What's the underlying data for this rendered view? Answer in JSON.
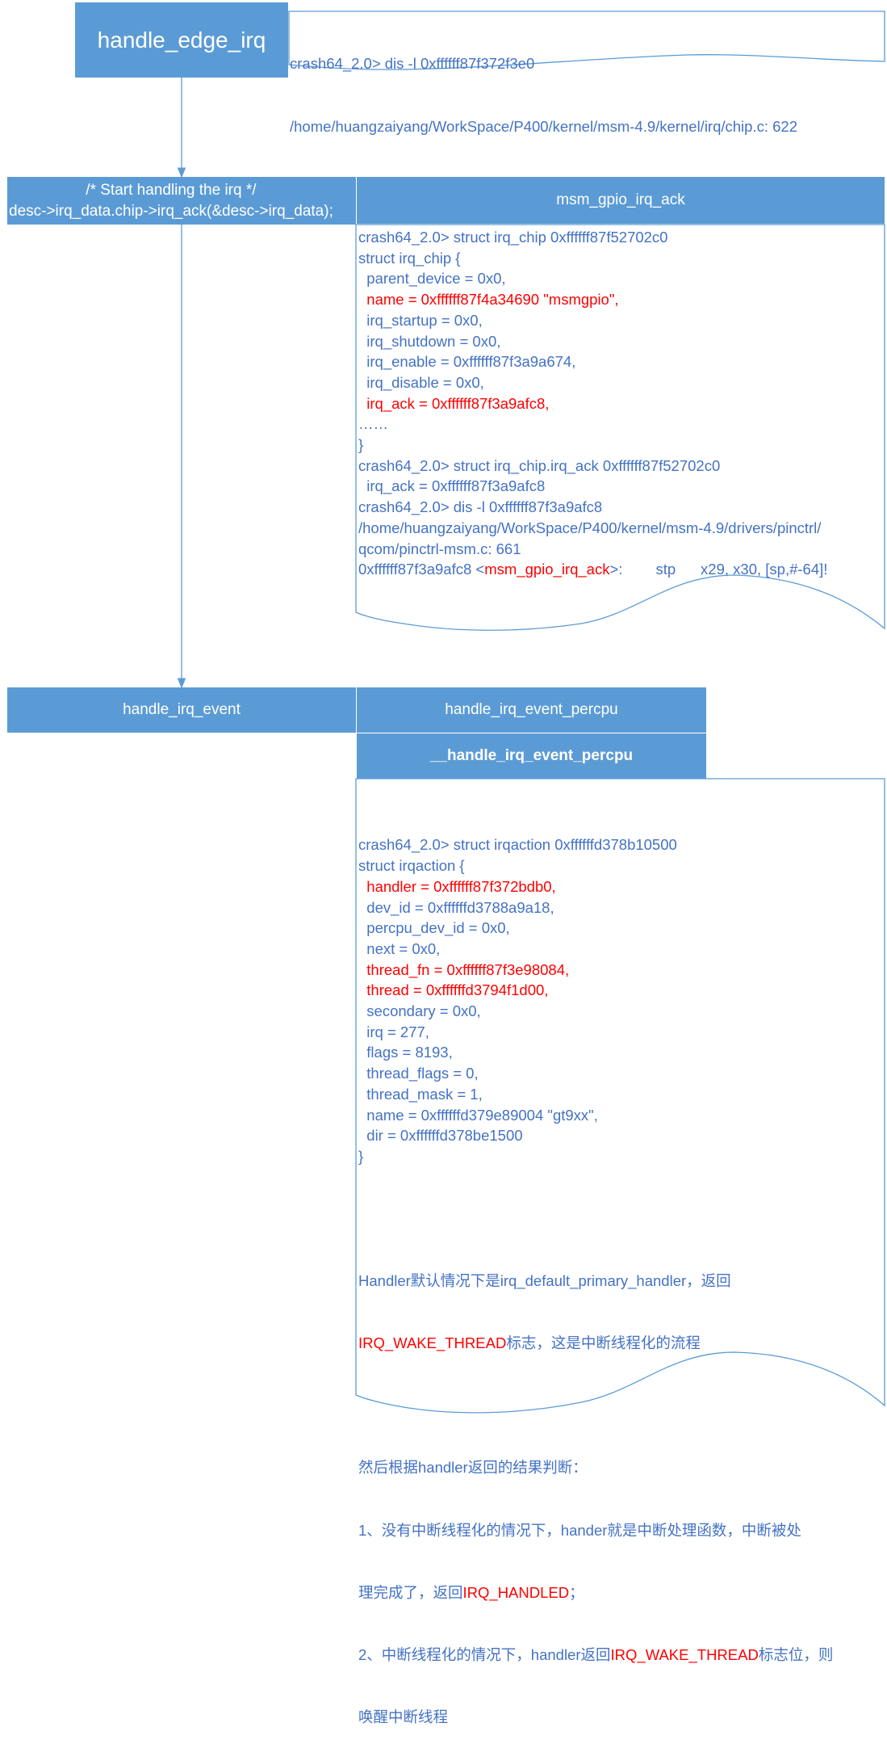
{
  "title_box": {
    "label": "handle_edge_irq"
  },
  "header_note": {
    "lines": [
      "crash64_2.0> dis -l 0xffffff87f372f3e0",
      "/home/huangzaiyang/WorkSpace/P400/kernel/msm-4.9/kernel/irq/chip.c: 622"
    ]
  },
  "code_box": {
    "lines": [
      "/* Start handling the irq */",
      "desc->irq_data.chip->irq_ack(&desc->irq_data);"
    ]
  },
  "ack_box": {
    "label": "msm_gpio_irq_ack"
  },
  "irq_chip_note": {
    "lines": [
      {
        "text": "crash64_2.0> struct irq_chip 0xffffff87f52702c0",
        "red": false
      },
      {
        "text": "struct irq_chip {",
        "red": false
      },
      {
        "text": "  parent_device = 0x0,",
        "red": false
      },
      {
        "text": "  name = 0xffffff87f4a34690 \"msmgpio\",",
        "red": true
      },
      {
        "text": "  irq_startup = 0x0,",
        "red": false
      },
      {
        "text": "  irq_shutdown = 0x0,",
        "red": false
      },
      {
        "text": "  irq_enable = 0xffffff87f3a9a674,",
        "red": false
      },
      {
        "text": "  irq_disable = 0x0,",
        "red": false
      },
      {
        "text": "  irq_ack = 0xffffff87f3a9afc8,",
        "red": true
      },
      {
        "text": "……",
        "red": false
      },
      {
        "text": "}",
        "red": false
      },
      {
        "text": "crash64_2.0> struct irq_chip.irq_ack 0xffffff87f52702c0",
        "red": false
      },
      {
        "text": "  irq_ack = 0xffffff87f3a9afc8",
        "red": false
      },
      {
        "text": "crash64_2.0> dis -l 0xffffff87f3a9afc8",
        "red": false
      },
      {
        "text": "/home/huangzaiyang/WorkSpace/P400/kernel/msm-4.9/drivers/pinctrl/",
        "red": false
      },
      {
        "text": "qcom/pinctrl-msm.c: 661",
        "red": false
      }
    ],
    "last_line": {
      "prefix": "0xffffff87f3a9afc8 <",
      "func": "msm_gpio_irq_ack",
      "suffix": ">:        stp      x29, x30, [sp,#-64]!"
    }
  },
  "event_box": {
    "label": "handle_irq_event"
  },
  "percpu_box": {
    "label": "handle_irq_event_percpu"
  },
  "inner_percpu_box": {
    "label": "__handle_irq_event_percpu"
  },
  "irqaction_note": {
    "lines": [
      {
        "text": "crash64_2.0> struct irqaction 0xffffffd378b10500",
        "red": false
      },
      {
        "text": "struct irqaction {",
        "red": false
      },
      {
        "text": "  handler = 0xffffff87f372bdb0,",
        "red": true
      },
      {
        "text": "  dev_id = 0xffffffd3788a9a18,",
        "red": false
      },
      {
        "text": "  percpu_dev_id = 0x0,",
        "red": false
      },
      {
        "text": "  next = 0x0,",
        "red": false
      },
      {
        "text": "  thread_fn = 0xffffff87f3e98084,",
        "red": true
      },
      {
        "text": "  thread = 0xffffffd3794f1d00,",
        "red": true
      },
      {
        "text": "  secondary = 0x0,",
        "red": false
      },
      {
        "text": "  irq = 277,",
        "red": false
      },
      {
        "text": "  flags = 8193,",
        "red": false
      },
      {
        "text": "  thread_flags = 0,",
        "red": false
      },
      {
        "text": "  thread_mask = 1,",
        "red": false
      },
      {
        "text": "  name = 0xffffffd379e89004 \"gt9xx\",",
        "red": false
      },
      {
        "text": "  dir = 0xffffffd378be1500",
        "red": false
      },
      {
        "text": "}",
        "red": false
      }
    ],
    "para1": {
      "a": "Handler默认情况下是irq_default_primary_handler，返回",
      "b_red": "IRQ_WAKE_THREAD",
      "c": "标志，这是中断线程化的流程"
    },
    "para2": {
      "title": "然后根据handler返回的结果判断：",
      "item1_a": "1、没有中断线程化的情况下，hander就是中断处理函数，中断被处",
      "item1_b": "理完成了，返回",
      "item1_red": "IRQ_HANDLED",
      "item1_c": "；",
      "item2_a": "2、中断线程化的情况下，handler返回",
      "item2_red": "IRQ_WAKE_THREAD",
      "item2_b": "标志位，则",
      "item2_c": "唤醒中断线程"
    }
  },
  "colors": {
    "box_fill": "#5b9bd5",
    "note_text": "#4472c4",
    "highlight": "#ff0000",
    "connector": "#5b9bd5"
  }
}
